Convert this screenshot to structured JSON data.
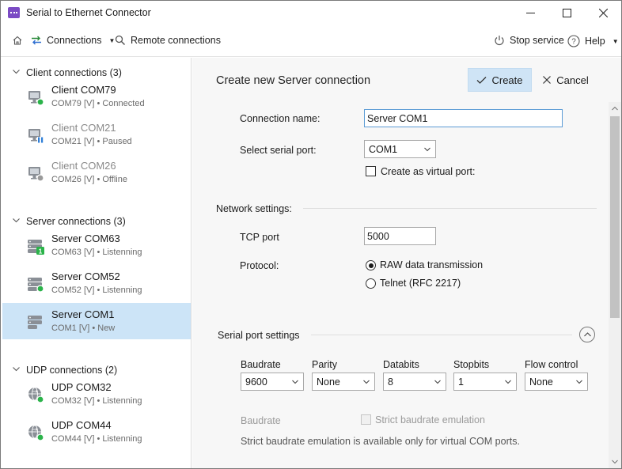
{
  "window": {
    "title": "Serial to Ethernet Connector"
  },
  "toolbar": {
    "home_icon": "home-icon",
    "connections_label": "Connections",
    "remote_label": "Remote connections",
    "stop_label": "Stop service",
    "help_label": "Help"
  },
  "sidebar": {
    "groups": [
      {
        "label": "Client connections (3)",
        "items": [
          {
            "name": "Client COM79",
            "detail": "COM79 [V] • Connected",
            "status": "connected",
            "icon": "monitor-icon"
          },
          {
            "name": "Client COM21",
            "detail": "COM21 [V] • Paused",
            "status": "paused",
            "icon": "monitor-icon"
          },
          {
            "name": "Client COM26",
            "detail": "COM26 [V] • Offline",
            "status": "offline",
            "icon": "monitor-icon"
          }
        ]
      },
      {
        "label": "Server connections (3)",
        "items": [
          {
            "name": "Server COM63",
            "detail": "COM63 [V] • Listenning",
            "status": "listening-one",
            "icon": "server-icon"
          },
          {
            "name": "Server COM52",
            "detail": "COM52 [V] • Listenning",
            "status": "listening",
            "icon": "server-icon"
          },
          {
            "name": "Server COM1",
            "detail": "COM1 [V] • New",
            "status": "new",
            "icon": "server-icon",
            "selected": true
          }
        ]
      },
      {
        "label": "UDP connections (2)",
        "items": [
          {
            "name": "UDP COM32",
            "detail": "COM32 [V] • Listenning",
            "status": "listening",
            "icon": "globe-icon"
          },
          {
            "name": "UDP COM44",
            "detail": "COM44 [V] • Listenning",
            "status": "listening",
            "icon": "globe-icon"
          }
        ]
      }
    ]
  },
  "form": {
    "title": "Create new Server connection",
    "create_label": "Create",
    "cancel_label": "Cancel",
    "connection_name_label": "Connection name:",
    "connection_name_value": "Server COM1",
    "serial_port_label": "Select serial port:",
    "serial_port_value": "COM1",
    "virtual_port_label": "Create as virtual port:",
    "network_title": "Network settings:",
    "tcp_port_label": "TCP port",
    "tcp_port_value": "5000",
    "protocol_label": "Protocol:",
    "protocol_option_raw": "RAW data transmission",
    "protocol_option_telnet": "Telnet (RFC 2217)",
    "serial_title": "Serial port settings",
    "baudrate_label": "Baudrate",
    "baudrate_value": "9600",
    "parity_label": "Parity",
    "parity_value": "None",
    "databits_label": "Databits",
    "databits_value": "8",
    "stopbits_label": "Stopbits",
    "stopbits_value": "1",
    "flow_label": "Flow control",
    "flow_value": "None",
    "strict_baud_label": "Baudrate",
    "strict_emulation_label": "Strict baudrate emulation",
    "strict_note": "Strict baudrate emulation is available only for virtual COM ports."
  },
  "colors": {
    "accent": "#cfe4f6",
    "selected": "#cce4f7",
    "status_green": "#2bb34a",
    "status_blue": "#2f7fd8",
    "status_gray": "#9a9a9a",
    "app_icon": "#7b4bc4"
  }
}
